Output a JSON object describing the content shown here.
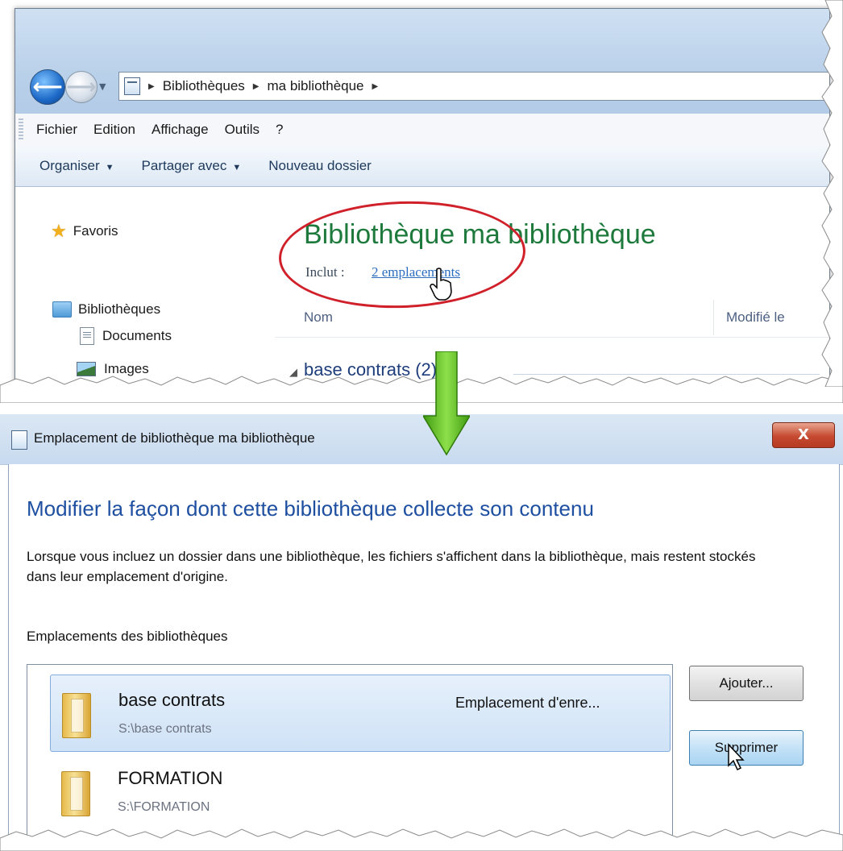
{
  "explorer": {
    "breadcrumb": [
      "Bibliothèques",
      "ma bibliothèque"
    ],
    "menu": [
      "Fichier",
      "Edition",
      "Affichage",
      "Outils",
      "?"
    ],
    "toolbar": {
      "organize": "Organiser",
      "share": "Partager avec",
      "new_folder": "Nouveau dossier"
    },
    "nav": {
      "favorites": "Favoris",
      "libraries": "Bibliothèques",
      "documents": "Documents",
      "images": "Images"
    },
    "content": {
      "title": "Bibliothèque ma bibliothèque",
      "includes_label": "Inclut :",
      "includes_link": "2 emplacements",
      "col_name": "Nom",
      "col_modified": "Modifié le",
      "group": "base contrats (2)"
    }
  },
  "dialog": {
    "title": "Emplacement de bibliothèque ma bibliothèque",
    "close_label": "X",
    "heading": "Modifier la façon dont cette bibliothèque collecte son contenu",
    "description": "Lorsque vous incluez un dossier dans une bibliothèque, les fichiers s'affichent dans la bibliothèque, mais restent stockés dans leur emplacement d'origine.",
    "list_label": "Emplacements des bibliothèques",
    "locations": [
      {
        "name": "base contrats",
        "path": "S:\\base contrats",
        "type": "Emplacement d'enre...",
        "selected": true
      },
      {
        "name": "FORMATION",
        "path": "S:\\FORMATION",
        "type": "",
        "selected": false
      }
    ],
    "buttons": {
      "add": "Ajouter...",
      "remove": "Supprimer"
    }
  },
  "colors": {
    "annotation_ellipse": "#d0202a",
    "annotation_arrow": "#5fbf1f",
    "library_title": "#1e7a3c",
    "dialog_heading": "#1e4fa0",
    "link": "#2c6dbf"
  }
}
